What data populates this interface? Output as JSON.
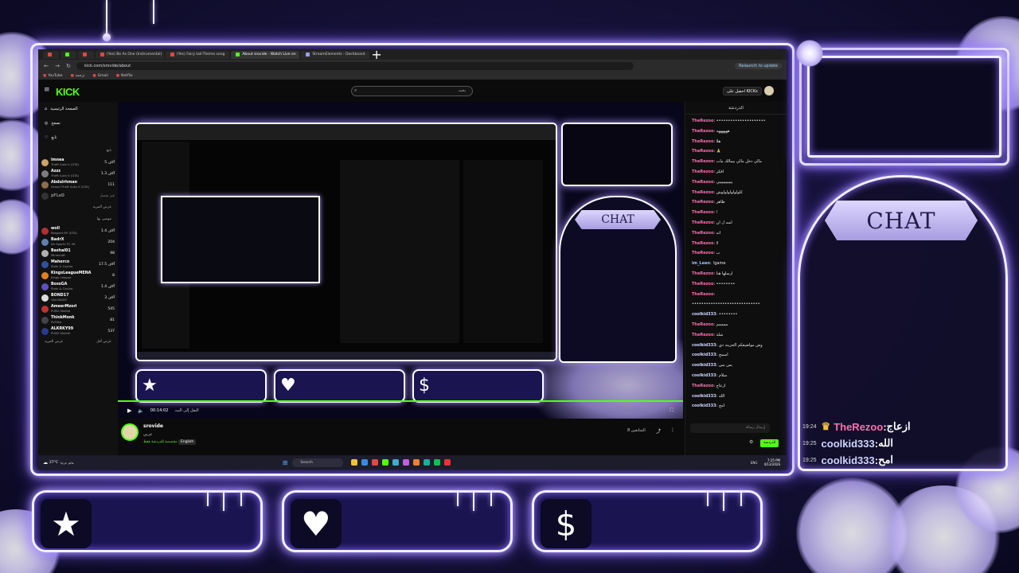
{
  "browser": {
    "tabs": [
      {
        "label": "",
        "color": "#e04848"
      },
      {
        "label": "",
        "color": "#53fc18"
      },
      {
        "label": "",
        "color": "#e04848"
      },
      {
        "label": "(Yes) Be As One (Instrumental)",
        "color": "#e04848"
      },
      {
        "label": "(Yes) Fairy tail-Theme song",
        "color": "#e04848"
      },
      {
        "label": "About srovide - Watch Live on",
        "color": "#53fc18",
        "active": true
      },
      {
        "label": "StreamElements - Dashboard",
        "color": "#9aa0ff"
      }
    ],
    "url": "kick.com/srovide/about",
    "relaunch": "Relaunch to update",
    "bookmarks": [
      "YouTube",
      "ترجمة",
      "Gmail",
      "Netflix"
    ]
  },
  "kick": {
    "logo": "KICK",
    "search_placeholder": "بحث",
    "signin": "احصل على KICKs",
    "nav": [
      {
        "label": "الصفحة الرئيسية",
        "icon": "home-icon"
      },
      {
        "label": "تصفح",
        "icon": "compass-icon"
      },
      {
        "label": "تابع",
        "icon": "heart-icon"
      }
    ],
    "following_title": "تابع",
    "following": [
      {
        "name": "lmnea",
        "game": "Theft Auto V (GTA)",
        "count": "5 آلاف",
        "av": "#c9a36a"
      },
      {
        "name": "Azzz",
        "game": "Theft Auto V (GTA)",
        "count": "1.3 آلاف",
        "av": "#7d7d7d"
      },
      {
        "name": "Abdulrhman",
        "game": "Grand Theft Auto V (GTA)",
        "count": "111",
        "av": "#8d6d4d"
      }
    ],
    "offline": "غير متصل",
    "offline_name": "pFLeD",
    "show_more": "عرض المزيد",
    "recommended_title": "موصى بها",
    "recommended": [
      {
        "name": "woll",
        "game": "Respect RP (GTA)",
        "count": "1.4 آلاف",
        "av": "#b03030"
      },
      {
        "name": "BadrX",
        "game": "EA Sports FC 26",
        "count": "204",
        "av": "#5e7fb0"
      },
      {
        "name": "Bashal01",
        "game": "Minecraft",
        "count": "98",
        "av": "#b0b0b0"
      },
      {
        "name": "Maherco",
        "game": "Slots & Casino",
        "count": "17.5 آلاف",
        "av": "#3050a0"
      },
      {
        "name": "KingsLeagueMENA",
        "game": "Kings League",
        "count": "8",
        "av": "#e08020"
      },
      {
        "name": "BossGA",
        "game": "Slots & Casino",
        "count": "1.4 آلاف",
        "av": "#6050c0"
      },
      {
        "name": "BOND17",
        "game": "VALORANT",
        "count": "3 آلاف",
        "av": "#ddd"
      },
      {
        "name": "AmeerMzori",
        "game": "PUBG Mobile",
        "count": "545",
        "av": "#c03030"
      },
      {
        "name": "ThinkMonk",
        "game": "PvPlike",
        "count": "81",
        "av": "#444"
      },
      {
        "name": "ALKRKY99",
        "game": "PUBG Mobile",
        "count": "537",
        "av": "#2a3a8a"
      }
    ],
    "show_more_2": "عرض المزيد",
    "show_less": "عرض أقل",
    "player_time": "00:14:02",
    "player_status": "النقل إلى البث",
    "streamer_name": "srovide",
    "streamer_sub": "عربي",
    "category_link": "مخصصة للدردشة فقط",
    "language_badge": "English",
    "followers": "المتابعين 8"
  },
  "chat": {
    "title": "الدردشة",
    "messages": [
      {
        "user": "TheRezoo",
        "text": "•••••••••••••••••••••",
        "color": "#ff6fae"
      },
      {
        "user": "TheRezoo",
        "text": "ههههههه",
        "color": "#ff6fae"
      },
      {
        "user": "TheRezoo",
        "text": "هلا",
        "color": "#ff6fae"
      },
      {
        "user": "TheRezoo",
        "text": "🙏",
        "color": "#ff6fae"
      },
      {
        "user": "TheRezoo",
        "text": "مالي دخل مالي بيمالك مات",
        "color": "#ff6fae"
      },
      {
        "user": "TheRezoo",
        "text": "افكر",
        "color": "#ff6fae"
      },
      {
        "user": "TheRezoo",
        "text": "يييييييييييي",
        "color": "#ff6fae"
      },
      {
        "user": "TheRezoo",
        "text": "كلولولولولولوش",
        "color": "#ff6fae"
      },
      {
        "user": "TheRezoo",
        "text": "طاهر",
        "color": "#ff6fae"
      },
      {
        "user": "TheRezoo",
        "text": "!",
        "color": "#ff6fae"
      },
      {
        "user": "TheRezoo",
        "text": "اسه ل ان",
        "color": "#ff6fae"
      },
      {
        "user": "TheRezoo",
        "text": "انه",
        "color": "#ff6fae"
      },
      {
        "user": "TheRezoo",
        "text": "لا",
        "color": "#ff6fae"
      },
      {
        "user": "TheRezoo",
        "text": "ب",
        "color": "#ff6fae"
      },
      {
        "user": "im_Leen",
        "text": "!game",
        "color": "#9fc4ff"
      },
      {
        "user": "TheRezoo",
        "text": "ارسلها هنا",
        "color": "#ff6fae"
      },
      {
        "user": "TheRezoo",
        "text": "••••••••",
        "color": "#ff6fae"
      },
      {
        "user": "TheRezoo",
        "text": "",
        "color": "#ff6fae"
      },
      {
        "user": "",
        "text": "•••••••••••••••••••••••••••••",
        "color": "#ffffff"
      },
      {
        "user": "coolkid333",
        "text": "••••••••",
        "color": "#cfd6ff"
      },
      {
        "user": "TheRezoo",
        "text": "ممممم",
        "color": "#ff6fae"
      },
      {
        "user": "TheRezoo",
        "text": "شلة",
        "color": "#ff6fae"
      },
      {
        "user": "coolkid333",
        "text": "وش مواضيعكم الحزينه ذي",
        "color": "#cfd6ff"
      },
      {
        "user": "coolkid333",
        "text": "اسمح",
        "color": "#cfd6ff"
      },
      {
        "user": "coolkid333",
        "text": "بس بس",
        "color": "#cfd6ff"
      },
      {
        "user": "coolkid333",
        "text": "سلام",
        "color": "#cfd6ff"
      },
      {
        "user": "TheRezoo",
        "text": "ازعاج",
        "color": "#ff6fae"
      },
      {
        "user": "coolkid333",
        "text": "الله",
        "color": "#cfd6ff"
      },
      {
        "user": "coolkid333",
        "text": "امح",
        "color": "#cfd6ff"
      }
    ],
    "input_placeholder": "إرسال رسالة",
    "send": "الدردشة"
  },
  "taskbar": {
    "weather_temp": "27°C",
    "weather_desc": "غائم جزئيا",
    "search": "Search",
    "lang": "ENG",
    "time": "7:25 PM",
    "date": "4/13/2026"
  },
  "overlay": {
    "chat_label": "CHAT",
    "small_chat_label": "CHAT",
    "big_chat": [
      {
        "time": "19:24",
        "user": "TheRezoo",
        "text": "ازعاج",
        "color": "#ff6fae",
        "crown": true
      },
      {
        "time": "19:25",
        "user": "coolkid333",
        "text": "الله",
        "color": "#cfd6ff",
        "crown": false
      },
      {
        "time": "19:25",
        "user": "coolkid333",
        "text": "امح",
        "color": "#cfd6ff",
        "crown": false
      }
    ],
    "alerts": [
      {
        "name": "follow-alert",
        "icon": "★",
        "icon_name": "star-icon"
      },
      {
        "name": "sub-alert",
        "icon": "♥",
        "icon_name": "heart-icon"
      },
      {
        "name": "donation-alert",
        "icon": "$",
        "icon_name": "dollar-icon"
      }
    ],
    "accent": "#7d5cff",
    "glow": "#b9a8ff"
  }
}
